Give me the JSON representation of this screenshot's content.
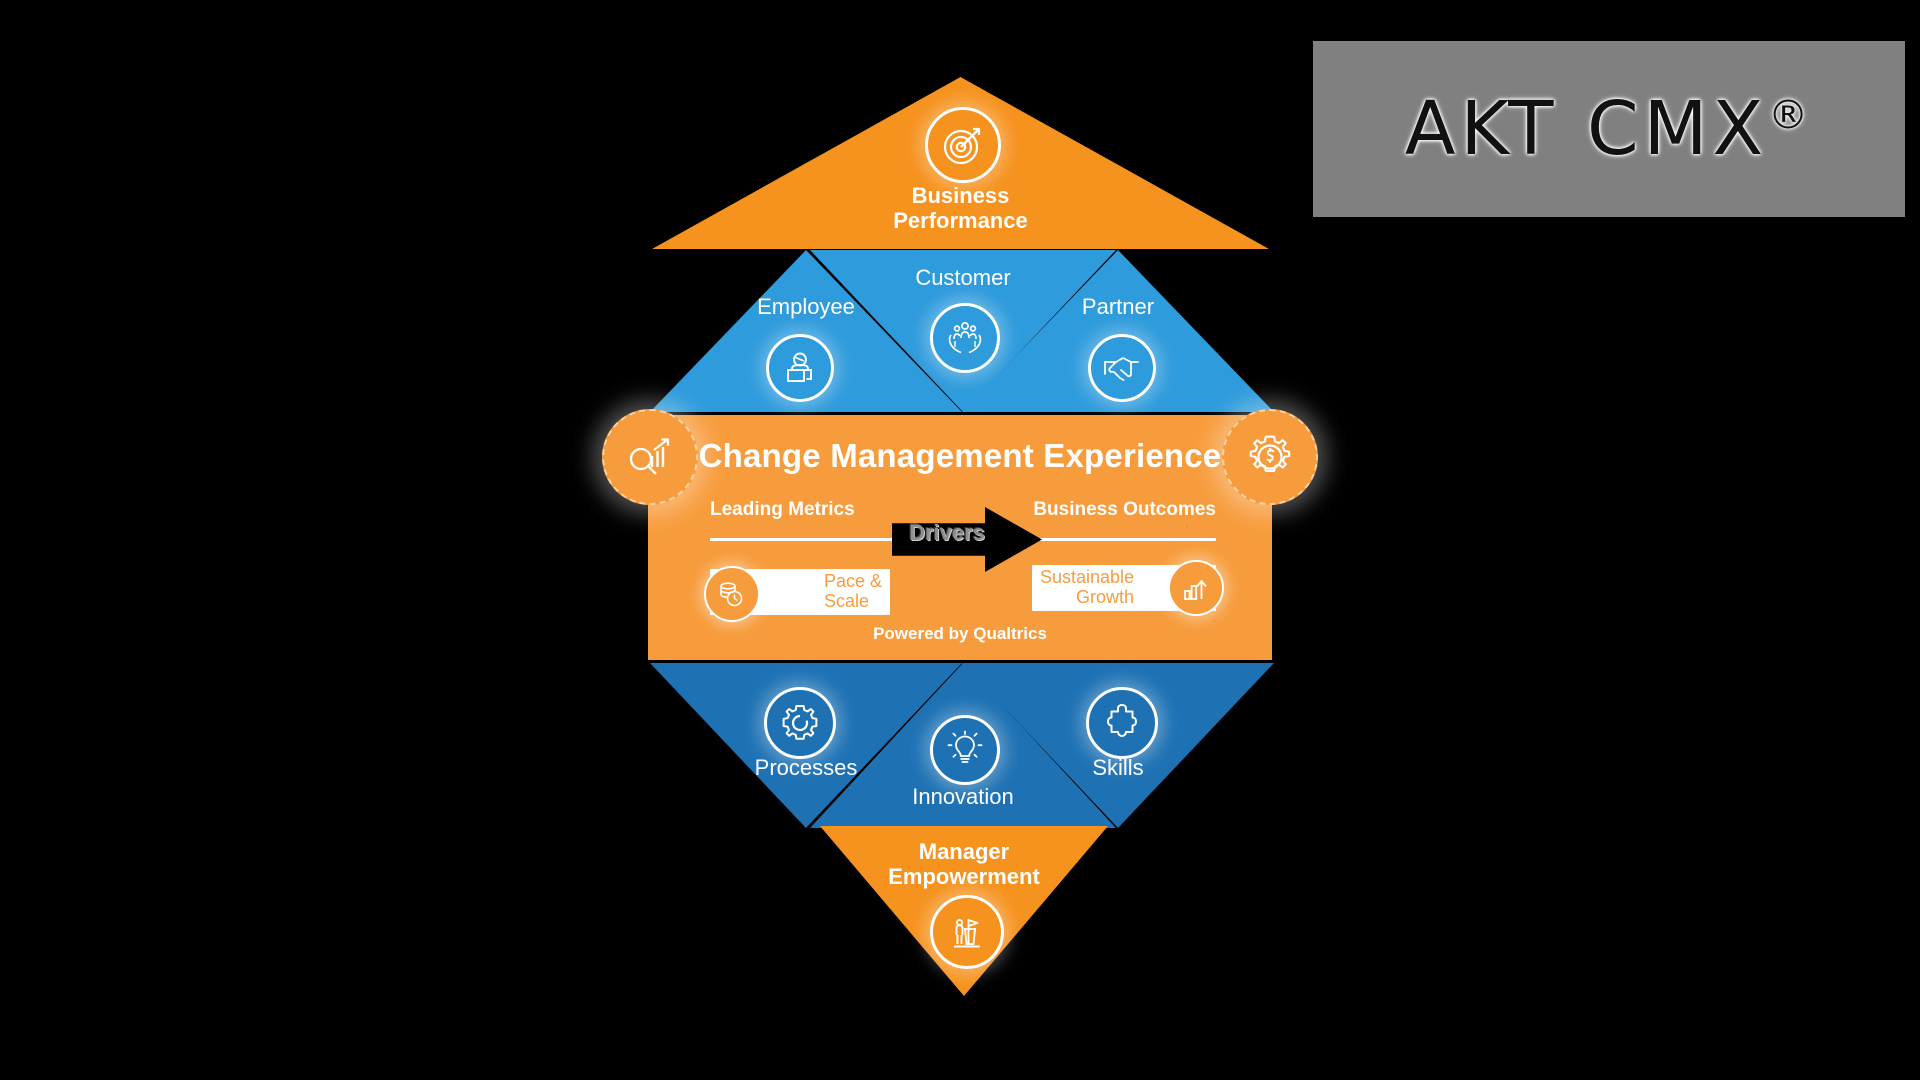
{
  "page": {
    "background_color": "#000000",
    "palette": {
      "orange": "#F6921E",
      "orange_band": "#F79C3C",
      "blue_light": "#2E9BDC",
      "blue_dark": "#1E72B4",
      "logo_gray": "#808080",
      "white": "#FFFFFF",
      "black": "#000000",
      "drivers_text": "#8D8D8D"
    }
  },
  "logo": {
    "text": "AKT CMX",
    "registered_mark": "®",
    "background_color": "#808080"
  },
  "diagram": {
    "name": "Change Management Experience Diamond",
    "top": {
      "label_line1": "Business",
      "label_line2": "Performance",
      "icon": "target-bullseye-icon",
      "color": "#F6921E",
      "direction": "up"
    },
    "row_experience": [
      {
        "label": "Employee",
        "icon": "employee-desk-icon",
        "color": "#2E9BDC",
        "direction": "up"
      },
      {
        "label": "Customer",
        "icon": "hands-holding-people-icon",
        "color": "#2E9BDC",
        "direction": "down"
      },
      {
        "label": "Partner",
        "icon": "handshake-icon",
        "color": "#2E9BDC",
        "direction": "up"
      }
    ],
    "row_capability": [
      {
        "label": "Processes",
        "icon": "gear-icon",
        "color": "#1E72B4",
        "direction": "down"
      },
      {
        "label": "Innovation",
        "icon": "lightbulb-icon",
        "color": "#1E72B4",
        "direction": "up"
      },
      {
        "label": "Skills",
        "icon": "puzzle-piece-icon",
        "color": "#1E72B4",
        "direction": "down"
      }
    ],
    "bottom": {
      "label_line1": "Manager",
      "label_line2": "Empowerment",
      "icon": "presenter-podium-icon",
      "color": "#F6921E",
      "direction": "down"
    }
  },
  "band": {
    "title": "Change Management Experience",
    "leading_metrics_label": "Leading Metrics",
    "business_outcomes_label": "Business Outcomes",
    "drivers_label": "Drivers",
    "left_circle_icon": "magnifier-bar-chart-icon",
    "right_circle_icon": "gear-dollar-icon",
    "chip_left": {
      "line1": "Pace &",
      "line2": "Scale",
      "icon": "coins-clock-icon"
    },
    "chip_right": {
      "line1": "Sustainable",
      "line2": "Growth",
      "icon": "bar-chart-arrow-up-icon"
    },
    "footer": "Powered by Qualtrics"
  }
}
